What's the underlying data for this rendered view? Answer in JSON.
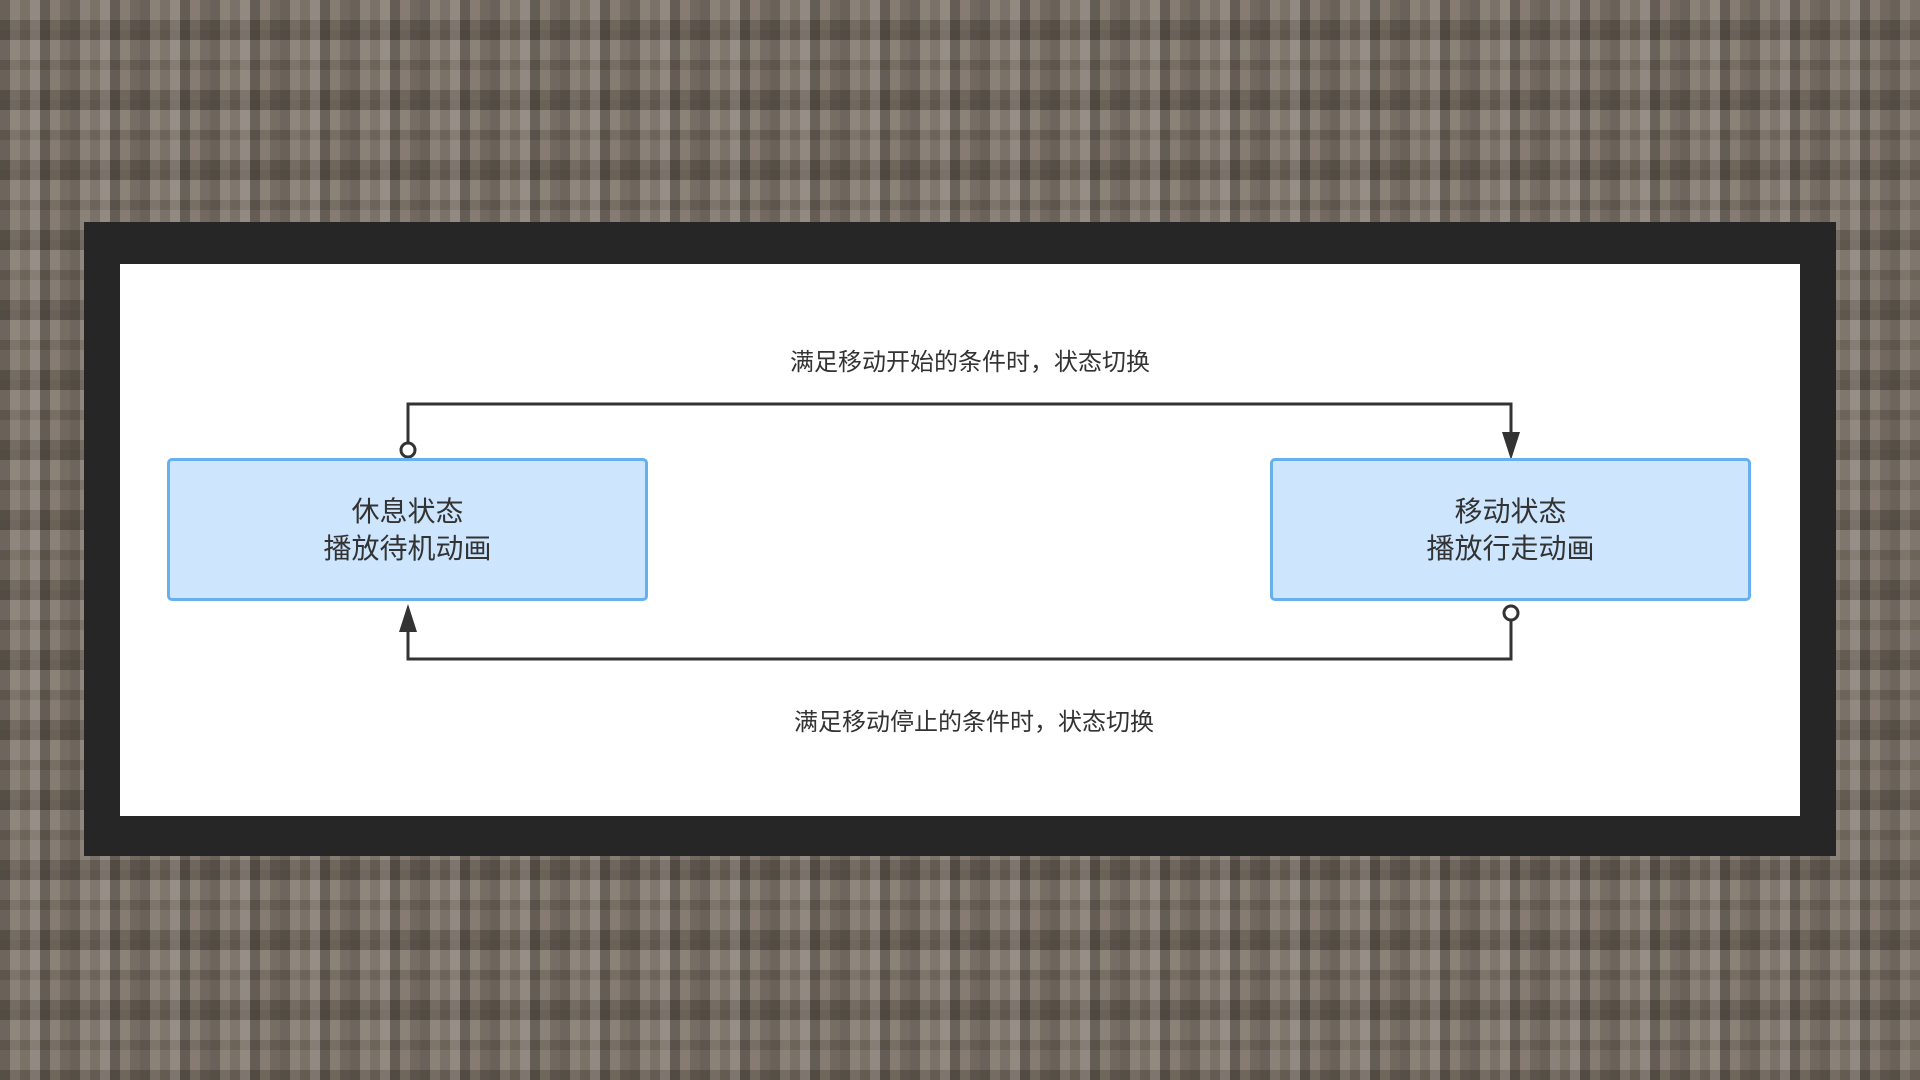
{
  "diagram": {
    "states": [
      {
        "id": "idle",
        "title": "休息状态",
        "subtitle": "播放待机动画"
      },
      {
        "id": "move",
        "title": "移动状态",
        "subtitle": "播放行走动画"
      }
    ],
    "transitions": [
      {
        "from": "idle",
        "to": "move",
        "label": "满足移动开始的条件时，状态切换"
      },
      {
        "from": "move",
        "to": "idle",
        "label": "满足移动停止的条件时，状态切换"
      }
    ]
  },
  "colors": {
    "background_texture": "#776d62",
    "frame": "#262626",
    "canvas": "#ffffff",
    "state_fill": "#cde6fe",
    "state_border": "#66b0ee",
    "edge": "#333333",
    "text": "#333333"
  }
}
